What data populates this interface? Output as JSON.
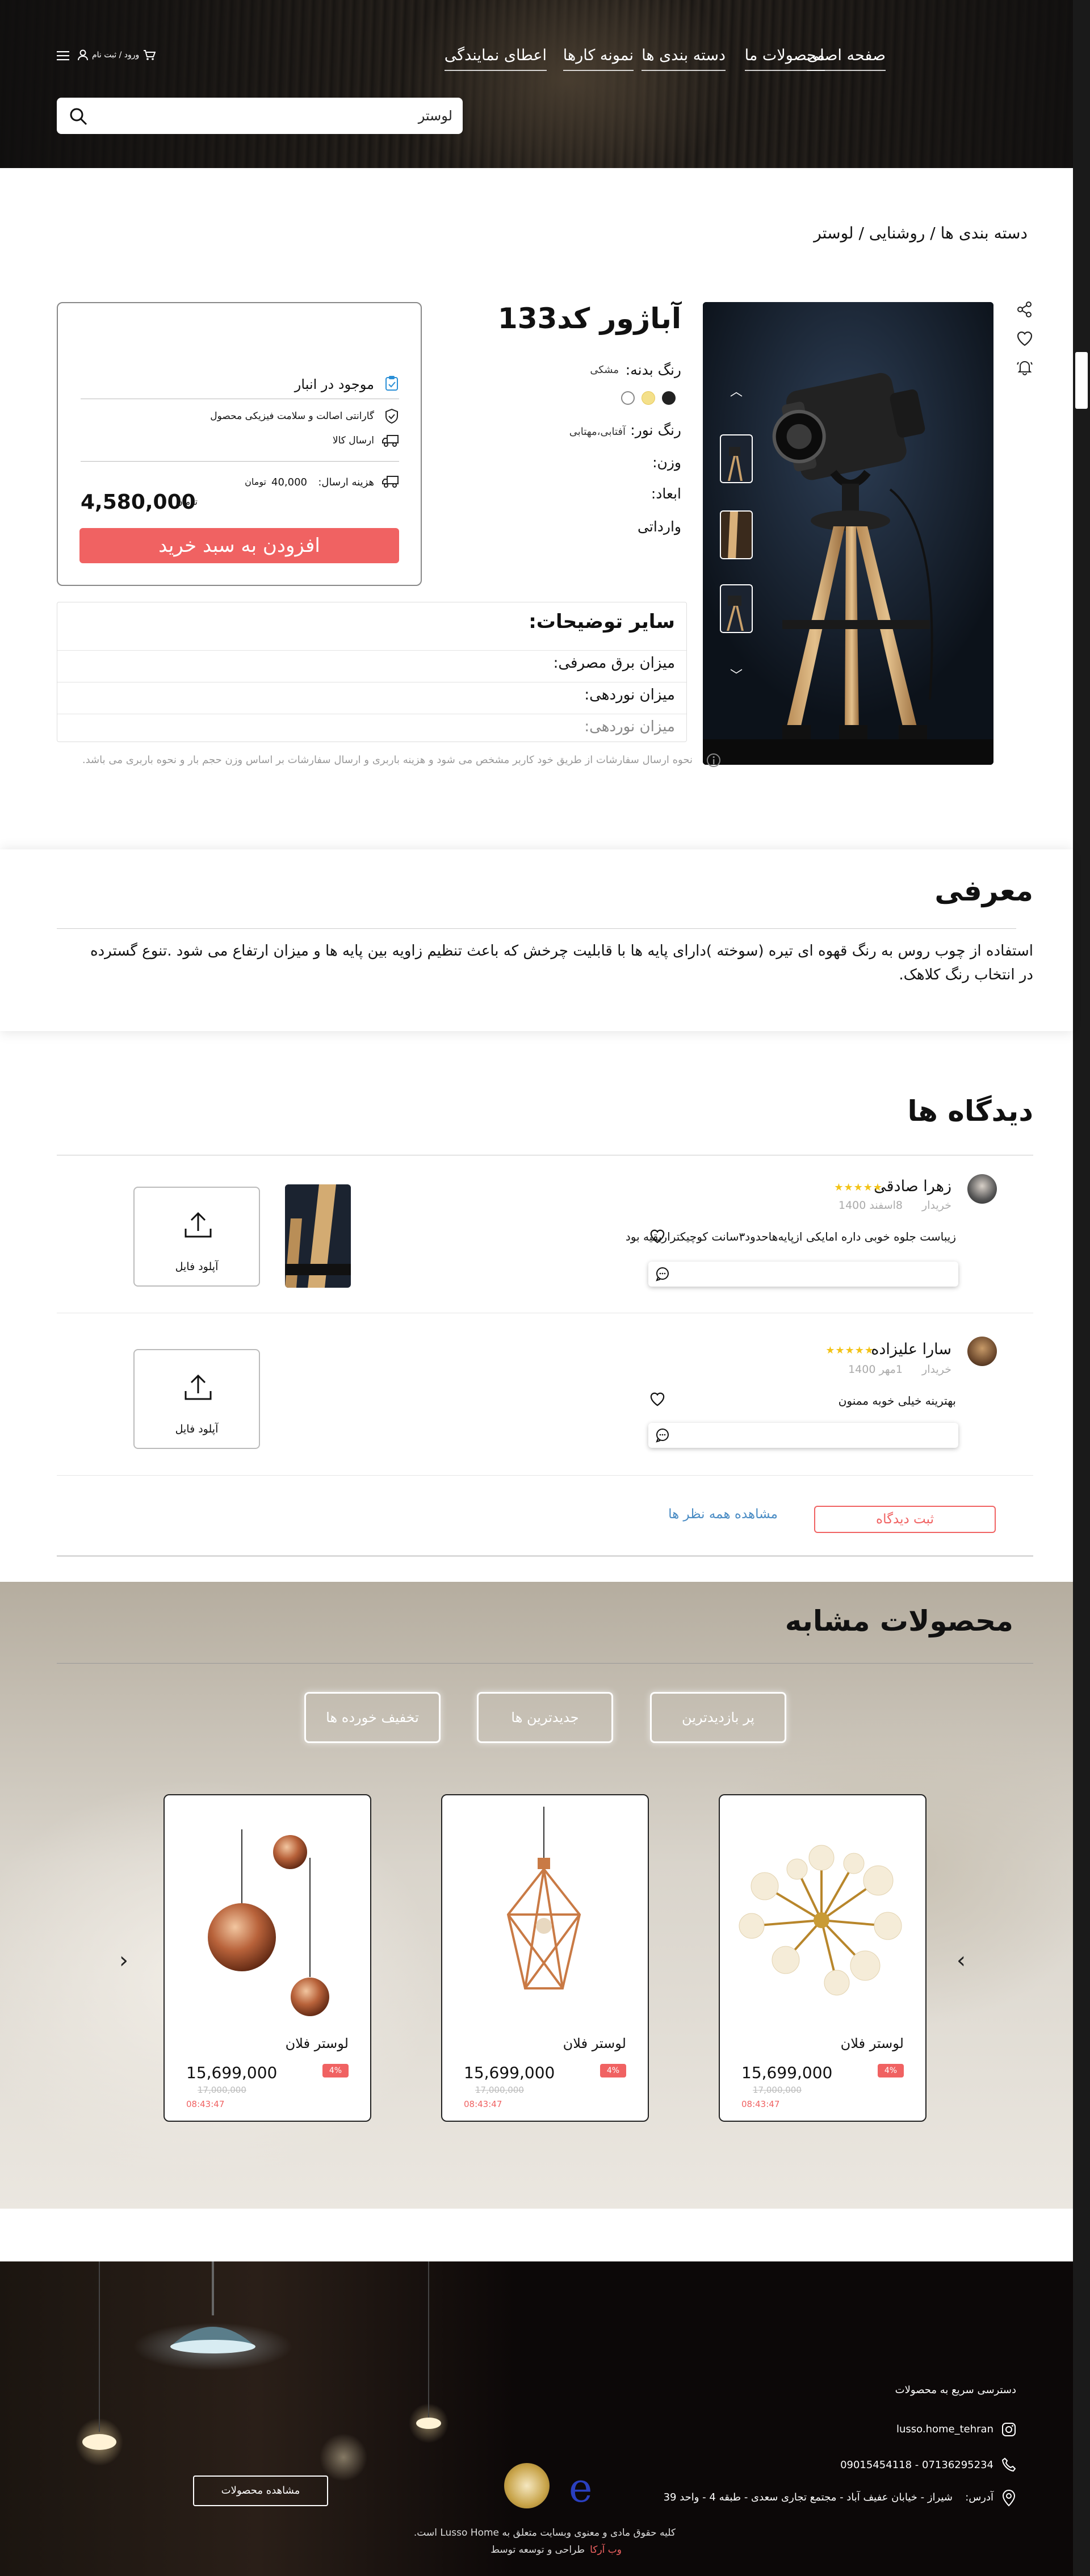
{
  "header": {
    "nav": [
      "صفحه اصلی",
      "محصولات ما",
      "دسته بندی ها",
      "نمونه کارها",
      "اعطای نمایندگی"
    ],
    "login_label": "ورود / ثبت نام",
    "search_value": "لوستر"
  },
  "breadcrumb": "دسته بندی ها / روشنایی / لوستر",
  "product": {
    "title": "آباژور کد133",
    "body_color_label": "رنگ بدنه:",
    "body_color_value": "مشکی",
    "light_color_label": "رنگ نور:",
    "light_color_value": "آفتابی،مهتابی",
    "weight_label": "وزن:",
    "dimensions_label": "ابعاد:",
    "origin": "وارداتی",
    "swatch_colors": [
      "#222222",
      "#f4e08a",
      "#ffffff"
    ]
  },
  "buybox": {
    "in_stock": "موجود در انبار",
    "guarantee": "گارانتی اصالت و سلامت فیزیکی محصول",
    "shipping": "ارسال کالا",
    "shipping_cost_label": "هزینه ارسال:",
    "shipping_cost_value": "40,000",
    "currency": "تومان",
    "price": "4,580,000",
    "price_currency": "تومان",
    "add_to_cart": "افزودن به سبد خرید"
  },
  "details": {
    "title": "سایر توضیحات:",
    "rows": [
      "میزان برق مصرفی:",
      "میزان نوردهی:",
      "میزان نوردهی:"
    ]
  },
  "shipping_note": "نحوه ارسال سفارشات از طریق خود کاربر مشخص می شود و هزینه باربری  و ارسال سفارشات بر اساس وزن حجم بار و  نحوه باربری  می باشد.",
  "intro": {
    "title": "معرفی",
    "text": "استفاده از چوب روس به رنگ قهوه ای تیره (سوخته )دارای پایه ها با قابلیت چرخش که باعث تنظیم زاویه بین پایه ها و میزان ارتفاع می شود .تنوع گسترده در انتخاب رنگ کلاهک."
  },
  "comments": {
    "title": "دیدگاه ها",
    "items": [
      {
        "name": "زهرا صادقی",
        "stars": "★★★★★",
        "role": "خریدار",
        "date": "8اسفند 1400",
        "text": "زیباست جلوه خوبی داره امایکی ازپایه‌هاحدود۳سانت کوچیکتراربقیه بود"
      },
      {
        "name": "سارا علیزاده",
        "stars": "★★★★★",
        "role": "خریدار",
        "date": "1مهر 1400",
        "text": "بهترینه خیلی خوبه ممنون"
      }
    ],
    "upload_label": "آپلود فایل",
    "submit": "ثبت دیدگاه",
    "see_all": "مشاهده همه نظر ها"
  },
  "similar": {
    "title": "محصولات مشابه",
    "tabs": [
      "پر بازدیدترین",
      "جدیدترین ها",
      "تخفیف خورده ها"
    ],
    "products": [
      {
        "name": "لوستر فلان",
        "badge": "4%",
        "price": "15,699,000",
        "old": "17,000,000",
        "timer": "08:43:47"
      },
      {
        "name": "لوستر فلان",
        "badge": "4%",
        "price": "15,699,000",
        "old": "17,000,000",
        "timer": "08:43:47"
      },
      {
        "name": "لوستر فلان",
        "badge": "4%",
        "price": "15,699,000",
        "old": "17,000,000",
        "timer": "08:43:47"
      }
    ]
  },
  "footer": {
    "quick_access": "دسترسی سریع به محصولات",
    "instagram": "lusso.home_tehran",
    "phones": "07136295234 - 09015454118",
    "address_label": "آدرس:",
    "address": "شیراز - خیابان عفیف آباد - مجتمع تجاری سعدی - طبقه 4 - واحد 39",
    "view_products": "مشاهده محصولات",
    "copyright": "کلیه حقوق مادی و معنوی وبسایت متعلق به Lusso Home است.",
    "credit_prefix": "طراحی و توسعه توسط",
    "credit_name": "وب آرکا"
  }
}
